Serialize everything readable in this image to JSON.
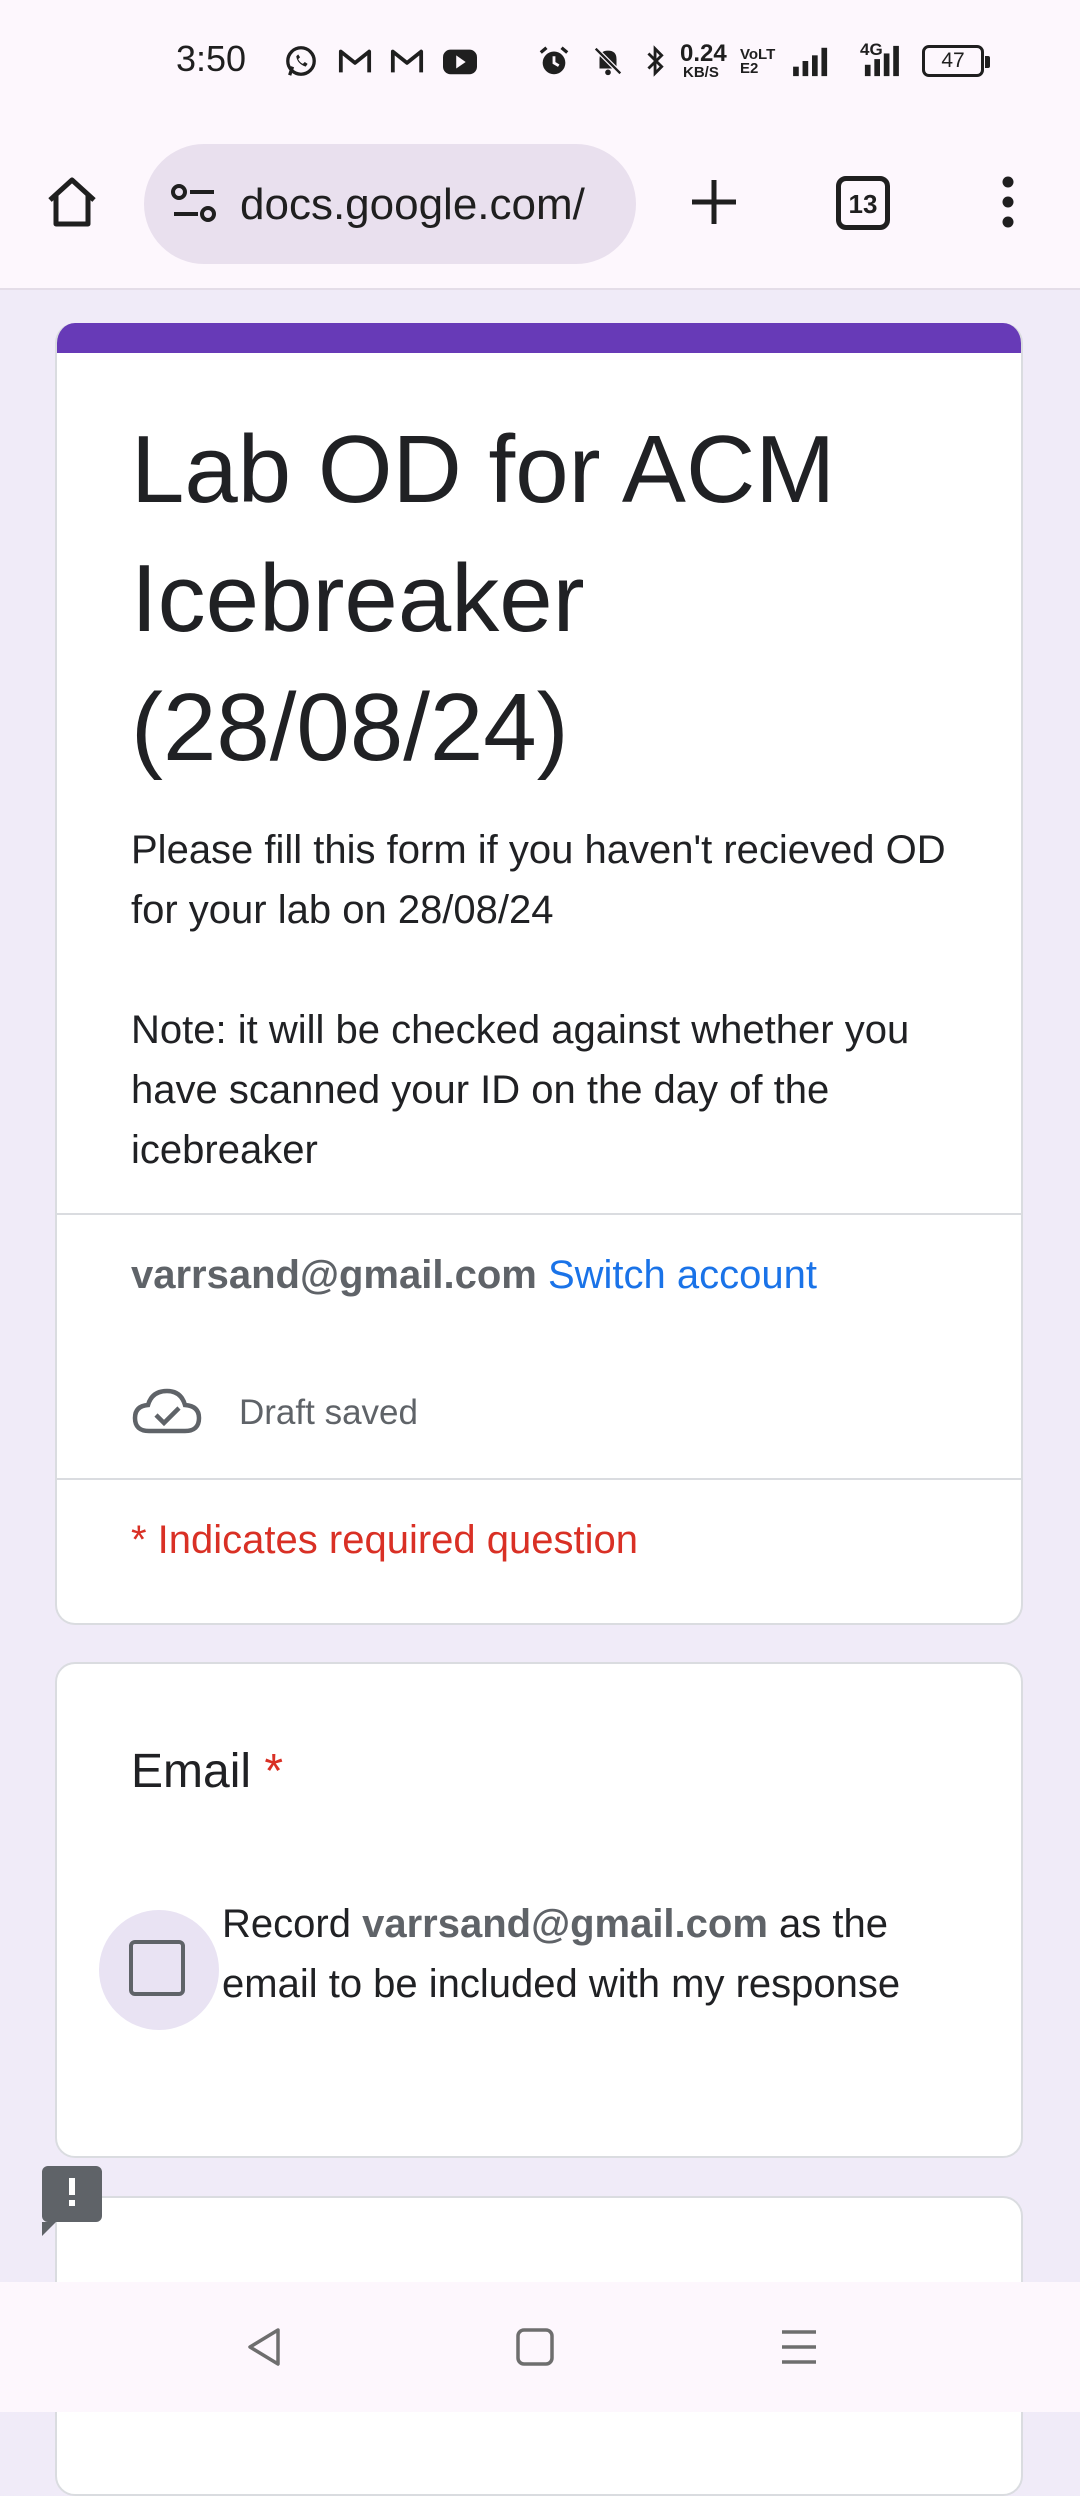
{
  "status_bar": {
    "time": "3:50",
    "net_speed": "0.24",
    "net_unit": "KB/S",
    "volte": "VoLTE2",
    "network": "4G",
    "battery": "47",
    "icons": [
      "whatsapp-icon",
      "gmail-icon",
      "gmail-icon",
      "youtube-icon",
      "alarm-icon",
      "mute-icon",
      "bluetooth-icon",
      "signal-icon",
      "signal-icon"
    ]
  },
  "browser": {
    "url": "docs.google.com/",
    "tab_count": "13",
    "icons": [
      "home-icon",
      "site-info-icon",
      "new-tab-icon",
      "tabs-icon",
      "menu-icon"
    ]
  },
  "form": {
    "title": "Lab OD for ACM Icebreaker (28/08/24)",
    "description": "Please fill this form if you haven't recieved OD for your lab on 28/08/24\n\nNote: it will be checked against whether you have scanned your ID on the day of the icebreaker",
    "account_email": "varrsand@gmail.com",
    "switch_account": "Switch account",
    "draft_status": "Draft saved",
    "required_note": "* Indicates required question",
    "accent_color": "#673ab7"
  },
  "question": {
    "title": "Email",
    "required_mark": "*",
    "checkbox_prefix": "Record",
    "checkbox_email": "varrsand@gmail.com",
    "checkbox_suffix": "as the email to be included with my response",
    "checked": false
  },
  "nav_bar": {
    "icons": [
      "back-icon",
      "home-square-icon",
      "recents-icon"
    ]
  }
}
